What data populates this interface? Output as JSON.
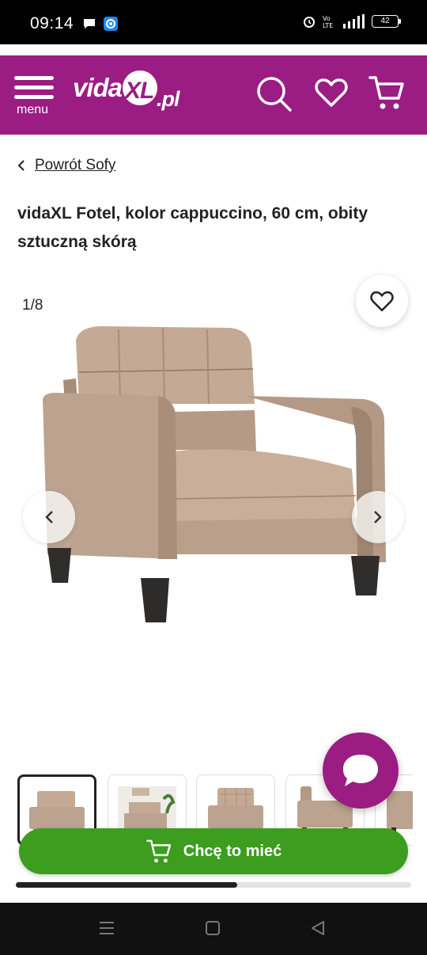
{
  "status_bar": {
    "time": "09:14",
    "battery": "42"
  },
  "header": {
    "menu_label": "menu",
    "logo_text": "vidaXL.pl",
    "brand_color": "#9b1c82"
  },
  "breadcrumb": {
    "back_label": "Powrót Sofy"
  },
  "product": {
    "title": "vidaXL Fotel, kolor cappuccino, 60 cm, obity sztuczną skórą",
    "image_counter": "1/8"
  },
  "gallery": {
    "progress": 0.56
  },
  "cta": {
    "label": "Chcę to mieć",
    "color": "#3c9d1e"
  },
  "icons": {
    "header": [
      "menu-icon",
      "search-icon",
      "heart-icon",
      "cart-icon"
    ],
    "product": [
      "favorite-heart-icon",
      "chevron-left-icon",
      "chevron-right-icon",
      "chat-bubble-icon",
      "cart-icon"
    ]
  }
}
